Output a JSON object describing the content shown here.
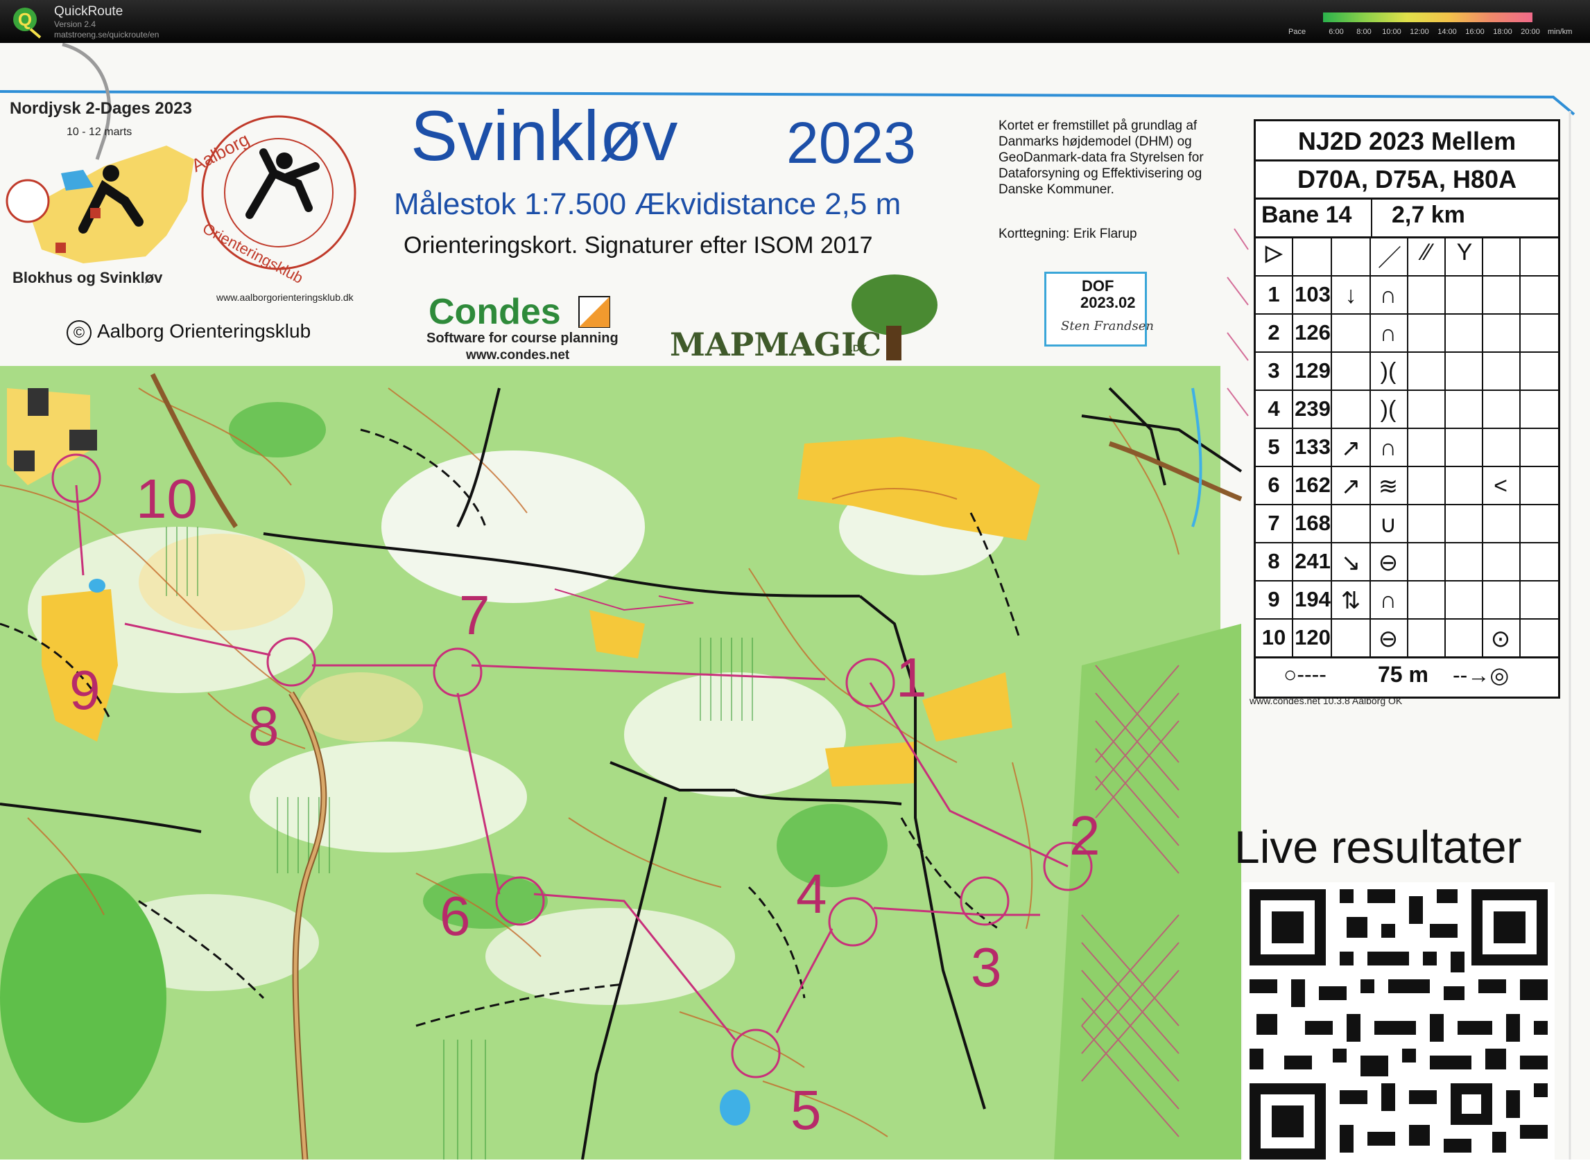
{
  "app": {
    "name": "QuickRoute",
    "version": "Version 2.4",
    "url": "matstroeng.se/quickroute/en"
  },
  "pace_legend": {
    "label": "Pace",
    "ticks": [
      "6:00",
      "8:00",
      "10:00",
      "12:00",
      "14:00",
      "16:00",
      "18:00",
      "20:00"
    ],
    "unit": "min/km",
    "colors": [
      "#2bb24c",
      "#8cd14a",
      "#e0e04a",
      "#f3c24a",
      "#f08a6a",
      "#f06a8a"
    ]
  },
  "header": {
    "event_left_title": "Nordjysk 2-Dages 2023",
    "event_left_date": "10 - 12 marts",
    "club_left_name": "Blokhus og Svinkløv",
    "club_url": "www.aalborgorienteringsklub.dk",
    "copyright": "©",
    "copyright_text": "Aalborg Orienteringsklub",
    "map_title": "Svinkløv",
    "map_year": "2023",
    "map_scale": "Målestok 1:7.500 Ækvidistance 2,5 m",
    "map_symbols": "Orienteringskort. Signaturer efter ISOM 2017",
    "condes_logo": "Condes",
    "condes_sub": "Software for course planning",
    "condes_url": "www.condes.net",
    "mapmagic": "MAPMAGIC",
    "mapmagic_dk": ".DK",
    "credits": "Kortet er fremstillet på grundlag af Danmarks højdemodel (DHM) og GeoDanmark-data fra Styrelsen for Dataforsyning og Effektivisering og Danske Kommuner.",
    "mapper": "Korttegning: Erik Flarup",
    "dof_label": "DOF",
    "dof_code": "2023.02",
    "dof_sign": "Sten Frandsen"
  },
  "control_card": {
    "title": "NJ2D 2023 Mellem",
    "classes": "D70A, D75A, H80A",
    "course": "Bane 14",
    "length": "2,7 km",
    "start_symbol": "▷",
    "header_symbols": [
      "／",
      "⁄⁄",
      "Y"
    ],
    "rows": [
      {
        "num": "1",
        "code": "103",
        "dir": "↓",
        "feature": "∩",
        "extra": ""
      },
      {
        "num": "2",
        "code": "126",
        "dir": "",
        "feature": "∩",
        "extra": ""
      },
      {
        "num": "3",
        "code": "129",
        "dir": "",
        "feature": ")(",
        "extra": ""
      },
      {
        "num": "4",
        "code": "239",
        "dir": "",
        "feature": ")(",
        "extra": ""
      },
      {
        "num": "5",
        "code": "133",
        "dir": "↗",
        "feature": "∩",
        "extra": ""
      },
      {
        "num": "6",
        "code": "162",
        "dir": "↗",
        "feature": "≋",
        "extra": "<"
      },
      {
        "num": "7",
        "code": "168",
        "dir": "",
        "feature": "∪",
        "extra": ""
      },
      {
        "num": "8",
        "code": "241",
        "dir": "↘",
        "feature": "⊖",
        "extra": ""
      },
      {
        "num": "9",
        "code": "194",
        "dir": "⇅",
        "feature": "∩",
        "extra": ""
      },
      {
        "num": "10",
        "code": "120",
        "dir": "",
        "feature": "⊖",
        "extra": "⊙"
      }
    ],
    "finish": "75 m",
    "footer": "www.condes.net 10.3.8 Aalborg OK"
  },
  "live": {
    "title": "Live resultater"
  },
  "map_controls": [
    {
      "label": "1"
    },
    {
      "label": "2"
    },
    {
      "label": "3"
    },
    {
      "label": "4"
    },
    {
      "label": "5"
    },
    {
      "label": "6"
    },
    {
      "label": "7"
    },
    {
      "label": "8"
    },
    {
      "label": "9"
    },
    {
      "label": "10"
    }
  ],
  "colors": {
    "course_magenta": "#b72a6a",
    "map_blue_text": "#1c4fa8",
    "forest_green": "#8fd06a",
    "open_yellow": "#f5c83a"
  }
}
